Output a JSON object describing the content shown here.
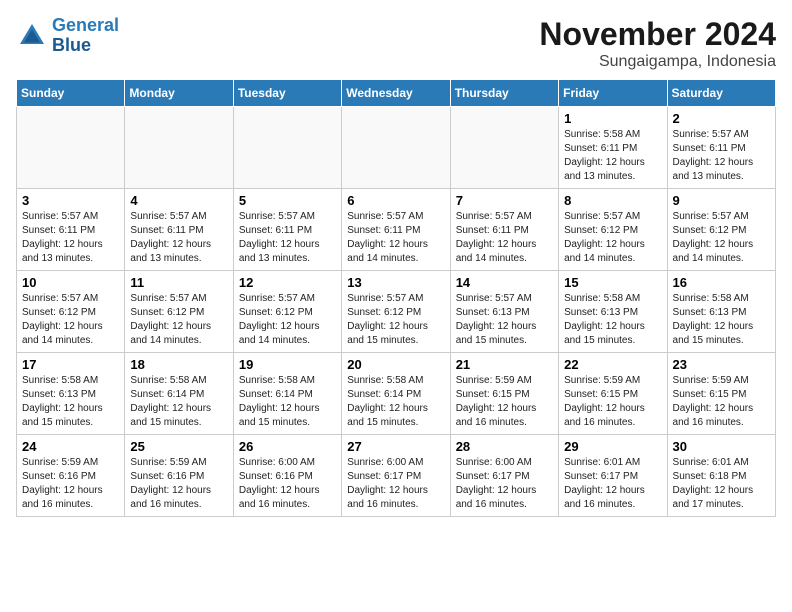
{
  "header": {
    "logo_line1": "General",
    "logo_line2": "Blue",
    "month": "November 2024",
    "location": "Sungaigampa, Indonesia"
  },
  "weekdays": [
    "Sunday",
    "Monday",
    "Tuesday",
    "Wednesday",
    "Thursday",
    "Friday",
    "Saturday"
  ],
  "weeks": [
    [
      {
        "day": "",
        "info": ""
      },
      {
        "day": "",
        "info": ""
      },
      {
        "day": "",
        "info": ""
      },
      {
        "day": "",
        "info": ""
      },
      {
        "day": "",
        "info": ""
      },
      {
        "day": "1",
        "info": "Sunrise: 5:58 AM\nSunset: 6:11 PM\nDaylight: 12 hours\nand 13 minutes."
      },
      {
        "day": "2",
        "info": "Sunrise: 5:57 AM\nSunset: 6:11 PM\nDaylight: 12 hours\nand 13 minutes."
      }
    ],
    [
      {
        "day": "3",
        "info": "Sunrise: 5:57 AM\nSunset: 6:11 PM\nDaylight: 12 hours\nand 13 minutes."
      },
      {
        "day": "4",
        "info": "Sunrise: 5:57 AM\nSunset: 6:11 PM\nDaylight: 12 hours\nand 13 minutes."
      },
      {
        "day": "5",
        "info": "Sunrise: 5:57 AM\nSunset: 6:11 PM\nDaylight: 12 hours\nand 13 minutes."
      },
      {
        "day": "6",
        "info": "Sunrise: 5:57 AM\nSunset: 6:11 PM\nDaylight: 12 hours\nand 14 minutes."
      },
      {
        "day": "7",
        "info": "Sunrise: 5:57 AM\nSunset: 6:11 PM\nDaylight: 12 hours\nand 14 minutes."
      },
      {
        "day": "8",
        "info": "Sunrise: 5:57 AM\nSunset: 6:12 PM\nDaylight: 12 hours\nand 14 minutes."
      },
      {
        "day": "9",
        "info": "Sunrise: 5:57 AM\nSunset: 6:12 PM\nDaylight: 12 hours\nand 14 minutes."
      }
    ],
    [
      {
        "day": "10",
        "info": "Sunrise: 5:57 AM\nSunset: 6:12 PM\nDaylight: 12 hours\nand 14 minutes."
      },
      {
        "day": "11",
        "info": "Sunrise: 5:57 AM\nSunset: 6:12 PM\nDaylight: 12 hours\nand 14 minutes."
      },
      {
        "day": "12",
        "info": "Sunrise: 5:57 AM\nSunset: 6:12 PM\nDaylight: 12 hours\nand 14 minutes."
      },
      {
        "day": "13",
        "info": "Sunrise: 5:57 AM\nSunset: 6:12 PM\nDaylight: 12 hours\nand 15 minutes."
      },
      {
        "day": "14",
        "info": "Sunrise: 5:57 AM\nSunset: 6:13 PM\nDaylight: 12 hours\nand 15 minutes."
      },
      {
        "day": "15",
        "info": "Sunrise: 5:58 AM\nSunset: 6:13 PM\nDaylight: 12 hours\nand 15 minutes."
      },
      {
        "day": "16",
        "info": "Sunrise: 5:58 AM\nSunset: 6:13 PM\nDaylight: 12 hours\nand 15 minutes."
      }
    ],
    [
      {
        "day": "17",
        "info": "Sunrise: 5:58 AM\nSunset: 6:13 PM\nDaylight: 12 hours\nand 15 minutes."
      },
      {
        "day": "18",
        "info": "Sunrise: 5:58 AM\nSunset: 6:14 PM\nDaylight: 12 hours\nand 15 minutes."
      },
      {
        "day": "19",
        "info": "Sunrise: 5:58 AM\nSunset: 6:14 PM\nDaylight: 12 hours\nand 15 minutes."
      },
      {
        "day": "20",
        "info": "Sunrise: 5:58 AM\nSunset: 6:14 PM\nDaylight: 12 hours\nand 15 minutes."
      },
      {
        "day": "21",
        "info": "Sunrise: 5:59 AM\nSunset: 6:15 PM\nDaylight: 12 hours\nand 16 minutes."
      },
      {
        "day": "22",
        "info": "Sunrise: 5:59 AM\nSunset: 6:15 PM\nDaylight: 12 hours\nand 16 minutes."
      },
      {
        "day": "23",
        "info": "Sunrise: 5:59 AM\nSunset: 6:15 PM\nDaylight: 12 hours\nand 16 minutes."
      }
    ],
    [
      {
        "day": "24",
        "info": "Sunrise: 5:59 AM\nSunset: 6:16 PM\nDaylight: 12 hours\nand 16 minutes."
      },
      {
        "day": "25",
        "info": "Sunrise: 5:59 AM\nSunset: 6:16 PM\nDaylight: 12 hours\nand 16 minutes."
      },
      {
        "day": "26",
        "info": "Sunrise: 6:00 AM\nSunset: 6:16 PM\nDaylight: 12 hours\nand 16 minutes."
      },
      {
        "day": "27",
        "info": "Sunrise: 6:00 AM\nSunset: 6:17 PM\nDaylight: 12 hours\nand 16 minutes."
      },
      {
        "day": "28",
        "info": "Sunrise: 6:00 AM\nSunset: 6:17 PM\nDaylight: 12 hours\nand 16 minutes."
      },
      {
        "day": "29",
        "info": "Sunrise: 6:01 AM\nSunset: 6:17 PM\nDaylight: 12 hours\nand 16 minutes."
      },
      {
        "day": "30",
        "info": "Sunrise: 6:01 AM\nSunset: 6:18 PM\nDaylight: 12 hours\nand 17 minutes."
      }
    ]
  ]
}
